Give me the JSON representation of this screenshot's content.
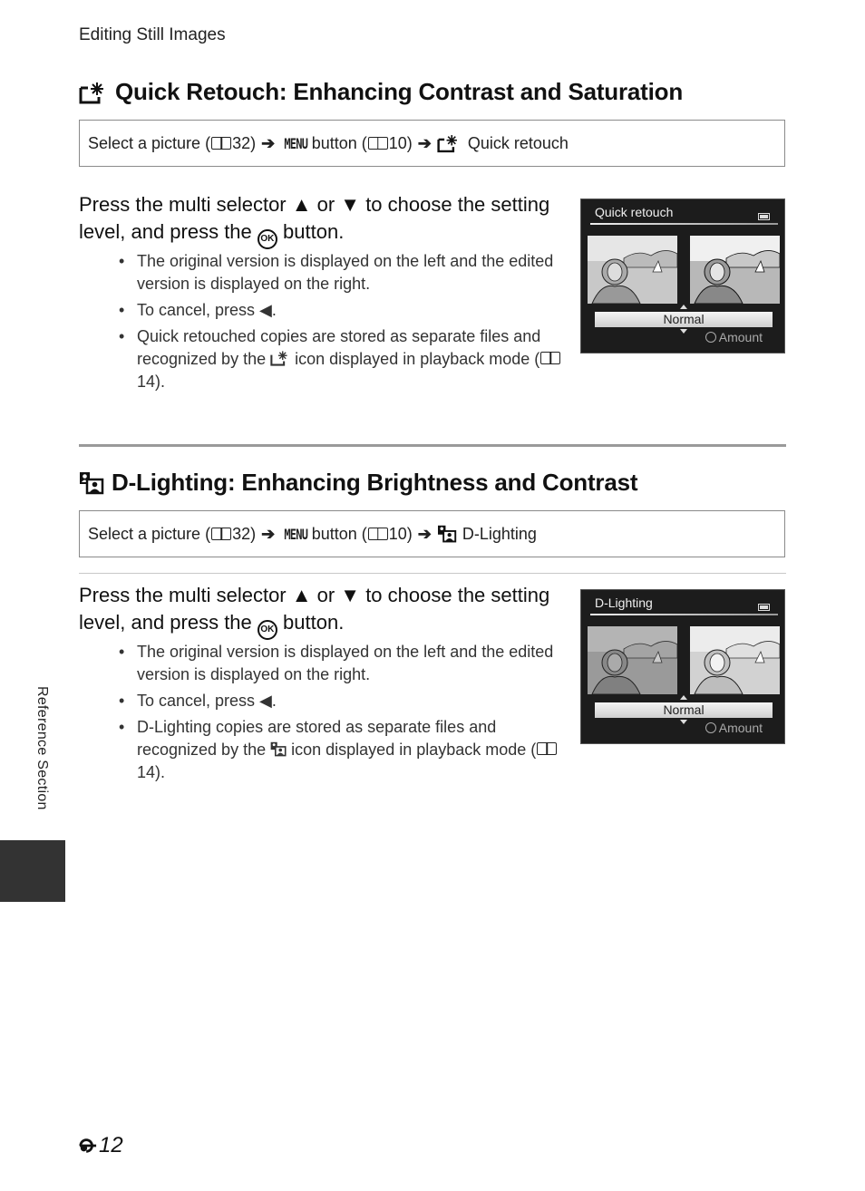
{
  "running_head": "Editing Still Images",
  "sections": [
    {
      "id": "quick-retouch",
      "icon": "quick-retouch-icon",
      "title": "Quick Retouch: Enhancing Contrast and Saturation",
      "path": {
        "select": "Select a picture (",
        "select_page": "32)",
        "menu_word": "MENU",
        "button": " button (",
        "button_page": "10)",
        "target": "Quick retouch"
      },
      "step": {
        "line_a": "Press the multi selector ▲ or ▼ to choose the setting level, and press the",
        "ok": "OK",
        "line_b": "button."
      },
      "bullets": [
        "The original version is displayed on the left and the edited version is displayed on the right.",
        "To cancel, press ◀.",
        "Quick retouched copies are stored as separate files and recognized by the",
        "icon displayed in playback mode (",
        "14)."
      ],
      "screen": {
        "title": "Quick retouch",
        "selected_value": "Normal",
        "hint": "Amount"
      }
    },
    {
      "id": "d-lighting",
      "icon": "d-lighting-icon",
      "title": "D-Lighting: Enhancing Brightness and Contrast",
      "path": {
        "select": "Select a picture (",
        "select_page": "32)",
        "menu_word": "MENU",
        "button": " button (",
        "button_page": "10)",
        "target": "D-Lighting"
      },
      "step": {
        "line_a": "Press the multi selector ▲ or ▼ to choose the setting level, and press the",
        "ok": "OK",
        "line_b": "button."
      },
      "bullets": [
        "The original version is displayed on the left and the edited version is displayed on the right.",
        "To cancel, press ◀.",
        "D-Lighting copies are stored as separate files and recognized by the",
        "icon displayed in playback mode (",
        "14)."
      ],
      "screen": {
        "title": "D-Lighting",
        "selected_value": "Normal",
        "hint": "Amount"
      }
    }
  ],
  "side_label": "Reference Section",
  "page_number": "12",
  "arrow_glyph": "➔"
}
